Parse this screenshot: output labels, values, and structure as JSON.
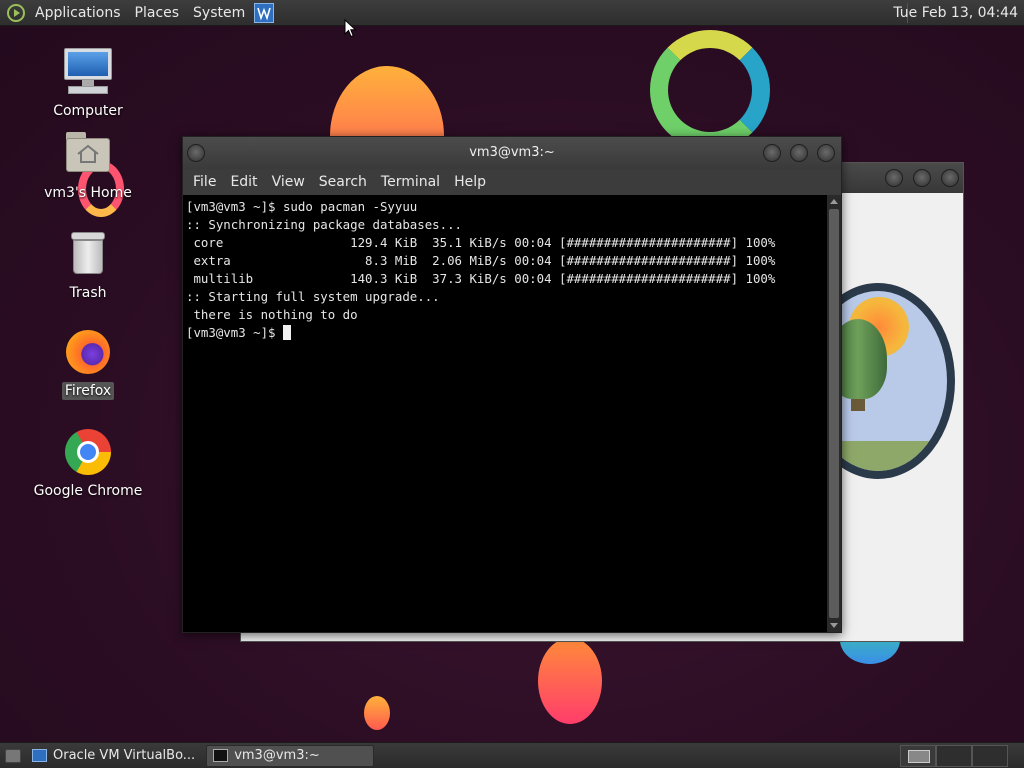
{
  "top_panel": {
    "menus": [
      "Applications",
      "Places",
      "System"
    ],
    "clock": "Tue Feb 13, 04:44"
  },
  "desktop_icons": [
    {
      "label": "Computer"
    },
    {
      "label": "vm3's Home"
    },
    {
      "label": "Trash"
    },
    {
      "label": "Firefox"
    },
    {
      "label": "Google Chrome"
    }
  ],
  "terminal": {
    "title": "vm3@vm3:~",
    "menu": [
      "File",
      "Edit",
      "View",
      "Search",
      "Terminal",
      "Help"
    ],
    "lines": [
      "[vm3@vm3 ~]$ sudo pacman -Syyuu",
      ":: Synchronizing package databases...",
      " core                 129.4 KiB  35.1 KiB/s 00:04 [######################] 100%",
      " extra                  8.3 MiB  2.06 MiB/s 00:04 [######################] 100%",
      " multilib             140.3 KiB  37.3 KiB/s 00:04 [######################] 100%",
      ":: Starting full system upgrade...",
      " there is nothing to do"
    ],
    "prompt": "[vm3@vm3 ~]$ "
  },
  "taskbar": {
    "items": [
      {
        "label": "Oracle VM VirtualBo...",
        "icon": "virtualbox-icon",
        "active": false
      },
      {
        "label": "vm3@vm3:~",
        "icon": "terminal-icon",
        "active": true
      }
    ]
  },
  "colors": {
    "desktop_bg": "#2b0d23",
    "panel_bg": "#333333",
    "terminal_bg": "#000000",
    "terminal_fg": "#e6e6e6"
  }
}
